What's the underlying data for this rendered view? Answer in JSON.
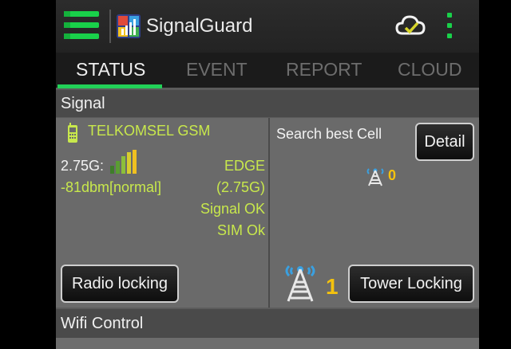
{
  "app": {
    "title": "SignalGuard"
  },
  "tabs": [
    {
      "label": "STATUS",
      "active": true
    },
    {
      "label": "EVENT",
      "active": false
    },
    {
      "label": "REPORT",
      "active": false
    },
    {
      "label": "CLOUD",
      "active": false
    }
  ],
  "sections": {
    "signal": "Signal",
    "wifi": "Wifi Control"
  },
  "signal_panel": {
    "carrier": "TELKOMSEL GSM",
    "network_gen": "2.75G:",
    "signal_strength": "-81dbm[normal]",
    "network_type": "EDGE",
    "network_type_sub": "(2.75G)",
    "signal_status": "Signal OK",
    "sim_status": "SIM Ok",
    "radio_locking_button": "Radio locking"
  },
  "cell_panel": {
    "search_label": "Search best Cell",
    "detail_button": "Detail",
    "best_cell_count": "0",
    "tower_count": "1",
    "tower_locking_button": "Tower Locking"
  },
  "colors": {
    "accent_green": "#22d158",
    "count_yellow": "#f4c20e",
    "status_yellow_green": "#c8e84c"
  },
  "icons": [
    "menu-icon",
    "app-logo-icon",
    "cloud-sync-icon",
    "more-vert-icon",
    "phone-icon",
    "signal-bars-icon",
    "tower-icon"
  ]
}
